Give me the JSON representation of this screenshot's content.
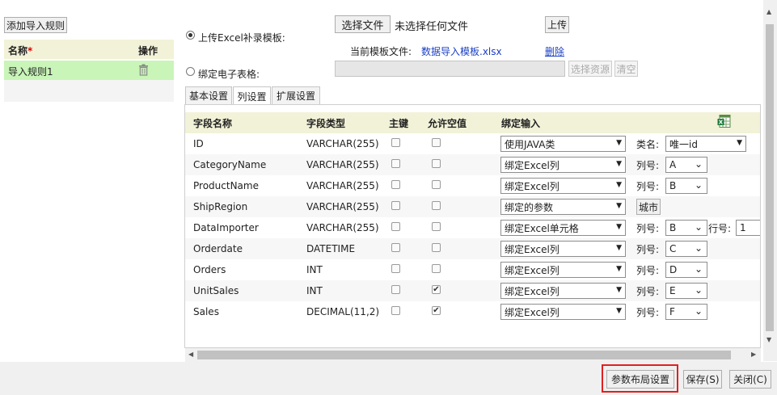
{
  "left_panel": {
    "add_rule_label": "添加导入规则",
    "header_name": "名称",
    "header_required": "*",
    "header_action": "操作",
    "rule_name": "导入规则1",
    "delete_icon": "trash-icon"
  },
  "import": {
    "upload_option_label": "上传Excel补录模板:",
    "choose_file_label": "选择文件",
    "no_file_text": "未选择任何文件",
    "upload_label": "上传",
    "current_template_label": "当前模板文件:",
    "current_template_file": "数据导入模板.xlsx",
    "delete_link": "删除",
    "bind_option_label": "绑定电子表格:",
    "bind_value": "",
    "select_resource_label": "选择资源",
    "clear_label": "清空"
  },
  "tabs": [
    "基本设置",
    "列设置",
    "扩展设置"
  ],
  "grid": {
    "headers": {
      "field_name": "字段名称",
      "field_type": "字段类型",
      "primary_key": "主键",
      "allow_null": "允许空值",
      "bind_input": "绑定输入"
    },
    "export_icon": "excel-export-icon",
    "rows": [
      {
        "name": "ID",
        "type": "VARCHAR(255)",
        "pk": false,
        "nullable": false,
        "bind": "使用JAVA类",
        "extra_label": "类名:",
        "extra_value": "唯一id"
      },
      {
        "name": "CategoryName",
        "type": "VARCHAR(255)",
        "pk": false,
        "nullable": false,
        "bind": "绑定Excel列",
        "extra_label": "列号:",
        "extra_value": "A"
      },
      {
        "name": "ProductName",
        "type": "VARCHAR(255)",
        "pk": false,
        "nullable": false,
        "bind": "绑定Excel列",
        "extra_label": "列号:",
        "extra_value": "B"
      },
      {
        "name": "ShipRegion",
        "type": "VARCHAR(255)",
        "pk": false,
        "nullable": false,
        "bind": "绑定的参数",
        "extra_button": "城市"
      },
      {
        "name": "DataImporter",
        "type": "VARCHAR(255)",
        "pk": false,
        "nullable": false,
        "bind": "绑定Excel单元格",
        "extra_label": "列号:",
        "extra_value": "B",
        "extra2_label": "行号:",
        "extra2_value": "1"
      },
      {
        "name": "Orderdate",
        "type": "DATETIME",
        "pk": false,
        "nullable": false,
        "bind": "绑定Excel列",
        "extra_label": "列号:",
        "extra_value": "C"
      },
      {
        "name": "Orders",
        "type": "INT",
        "pk": false,
        "nullable": false,
        "bind": "绑定Excel列",
        "extra_label": "列号:",
        "extra_value": "D"
      },
      {
        "name": "UnitSales",
        "type": "INT",
        "pk": false,
        "nullable": true,
        "bind": "绑定Excel列",
        "extra_label": "列号:",
        "extra_value": "E"
      },
      {
        "name": "Sales",
        "type": "DECIMAL(11,2)",
        "pk": false,
        "nullable": true,
        "bind": "绑定Excel列",
        "extra_label": "列号:",
        "extra_value": "F"
      }
    ]
  },
  "footer": {
    "param_layout_label": "参数布局设置",
    "save_label": "保存(S)",
    "close_label": "关闭(C)"
  },
  "colors": {
    "header_bg": "#f2f2d8",
    "selected_row_bg": "#c9f5b8",
    "highlight_border": "#e02020",
    "link": "#1a3fc4"
  }
}
